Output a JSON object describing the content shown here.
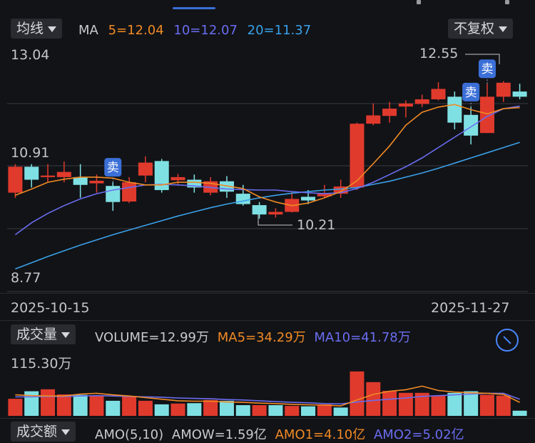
{
  "header": {
    "indicator_label": "均线",
    "ma_title": "MA",
    "ma5": "5=12.04",
    "ma10": "10=12.07",
    "ma20": "20=11.37",
    "adjust_label": "不复权"
  },
  "price_panel": {
    "high_label": "13.04",
    "mid_label": "10.91",
    "low_label": "8.77",
    "max_annot": "12.55",
    "min_annot": "10.21",
    "sell_markers": [
      "卖",
      "卖",
      "卖"
    ],
    "start_date": "2025-10-15",
    "end_date": "2025-11-27"
  },
  "volume_panel": {
    "indicator_label": "成交量",
    "volume": "VOLUME=12.99万",
    "ma5": "MA5=34.29万",
    "ma10": "MA10=41.78万",
    "max_label": "115.30万"
  },
  "amount_panel": {
    "indicator_label": "成交额",
    "amo": "AMO(5,10)",
    "amow": "AMOW=1.59亿",
    "amo1": "AMO1=4.10亿",
    "amo2": "AMO2=5.02亿"
  },
  "colors": {
    "up": "#e03a2d",
    "down": "#7fe0e3",
    "ma5": "#f08a24",
    "ma10": "#6a6df0",
    "ma20": "#3aa0e8",
    "marker": "#3b6fd8"
  },
  "chart_data": {
    "type": "candlestick",
    "ylim": [
      8.77,
      13.04
    ],
    "candles": [
      {
        "o": 10.4,
        "c": 10.9,
        "h": 10.95,
        "l": 10.3
      },
      {
        "o": 10.9,
        "c": 10.65,
        "h": 10.95,
        "l": 10.5
      },
      {
        "o": 10.7,
        "c": 10.73,
        "h": 10.95,
        "l": 10.6
      },
      {
        "o": 10.7,
        "c": 10.8,
        "h": 11.0,
        "l": 10.6
      },
      {
        "o": 10.7,
        "c": 10.55,
        "h": 10.95,
        "l": 10.3
      },
      {
        "o": 10.58,
        "c": 10.63,
        "h": 10.75,
        "l": 10.4
      },
      {
        "o": 10.53,
        "c": 10.22,
        "h": 10.6,
        "l": 10.05
      },
      {
        "o": 10.23,
        "c": 10.6,
        "h": 10.7,
        "l": 10.2
      },
      {
        "o": 10.73,
        "c": 10.98,
        "h": 11.1,
        "l": 10.6
      },
      {
        "o": 11.01,
        "c": 10.45,
        "h": 11.05,
        "l": 10.4
      },
      {
        "o": 10.64,
        "c": 10.7,
        "h": 10.76,
        "l": 10.55
      },
      {
        "o": 10.65,
        "c": 10.5,
        "h": 10.75,
        "l": 10.4
      },
      {
        "o": 10.4,
        "c": 10.62,
        "h": 10.7,
        "l": 10.35
      },
      {
        "o": 10.62,
        "c": 10.42,
        "h": 10.72,
        "l": 10.3
      },
      {
        "o": 10.38,
        "c": 10.18,
        "h": 10.55,
        "l": 10.15
      },
      {
        "o": 10.16,
        "c": 9.98,
        "h": 10.22,
        "l": 9.9
      },
      {
        "o": 9.98,
        "c": 10.03,
        "h": 10.1,
        "l": 9.92
      },
      {
        "o": 10.03,
        "c": 10.28,
        "h": 10.42,
        "l": 10.02
      },
      {
        "o": 10.32,
        "c": 10.25,
        "h": 10.45,
        "l": 10.18
      },
      {
        "o": 10.33,
        "c": 10.38,
        "h": 10.55,
        "l": 10.3
      },
      {
        "o": 10.38,
        "c": 10.52,
        "h": 10.65,
        "l": 10.3
      },
      {
        "o": 10.5,
        "c": 11.73,
        "h": 11.75,
        "l": 10.45
      },
      {
        "o": 11.73,
        "c": 11.89,
        "h": 12.12,
        "l": 11.7
      },
      {
        "o": 11.88,
        "c": 12.02,
        "h": 12.15,
        "l": 11.75
      },
      {
        "o": 12.06,
        "c": 12.12,
        "h": 12.18,
        "l": 11.85
      },
      {
        "o": 12.11,
        "c": 12.2,
        "h": 12.29,
        "l": 12.05
      },
      {
        "o": 12.2,
        "c": 12.4,
        "h": 12.53,
        "l": 12.18
      },
      {
        "o": 12.25,
        "c": 11.75,
        "h": 12.35,
        "l": 11.62
      },
      {
        "o": 11.9,
        "c": 11.5,
        "h": 12.05,
        "l": 11.33
      },
      {
        "o": 11.55,
        "c": 12.25,
        "h": 12.5,
        "l": 11.55
      },
      {
        "o": 12.25,
        "c": 12.52,
        "h": 12.55,
        "l": 12.15
      },
      {
        "o": 12.35,
        "c": 12.25,
        "h": 12.5,
        "l": 12.2
      }
    ],
    "ma5": [
      10.35,
      10.47,
      10.6,
      10.66,
      10.7,
      10.7,
      10.68,
      10.6,
      10.55,
      10.55,
      10.6,
      10.6,
      10.58,
      10.53,
      10.48,
      10.32,
      10.22,
      10.15,
      10.2,
      10.3,
      10.42,
      10.63,
      10.96,
      11.3,
      11.7,
      11.95,
      12.05,
      12.1,
      12.0,
      11.92,
      12.02,
      12.04
    ],
    "ma10": [
      9.59,
      9.82,
      10.0,
      10.15,
      10.28,
      10.38,
      10.45,
      10.5,
      10.55,
      10.56,
      10.55,
      10.53,
      10.5,
      10.47,
      10.46,
      10.45,
      10.45,
      10.42,
      10.4,
      10.38,
      10.4,
      10.48,
      10.6,
      10.75,
      10.9,
      11.07,
      11.27,
      11.47,
      11.67,
      11.87,
      12.02,
      12.07
    ],
    "ma20": [
      8.93,
      9.05,
      9.17,
      9.28,
      9.39,
      9.49,
      9.59,
      9.68,
      9.77,
      9.86,
      9.95,
      10.03,
      10.11,
      10.18,
      10.24,
      10.3,
      10.35,
      10.39,
      10.42,
      10.45,
      10.47,
      10.5,
      10.56,
      10.62,
      10.7,
      10.78,
      10.87,
      10.97,
      11.07,
      11.17,
      11.27,
      11.37
    ],
    "sell_indices": [
      6,
      28,
      29
    ],
    "volume": {
      "unit": "万",
      "ymax": 115.3,
      "values": [
        43,
        62,
        67,
        54,
        53,
        51,
        38,
        49,
        38,
        29,
        31,
        32,
        40,
        38,
        27,
        27,
        27,
        25,
        24,
        29,
        21,
        112,
        85,
        63,
        58,
        58,
        51,
        58,
        62,
        53,
        51,
        13
      ],
      "directions": [
        "up",
        "down",
        "up",
        "up",
        "down",
        "up",
        "down",
        "up",
        "up",
        "down",
        "up",
        "down",
        "up",
        "down",
        "down",
        "up",
        "down",
        "up",
        "down",
        "up",
        "down",
        "up",
        "up",
        "up",
        "up",
        "up",
        "up",
        "down",
        "down",
        "up",
        "up",
        "down"
      ],
      "ma5": [
        53,
        51,
        50,
        50,
        55,
        57,
        53,
        50,
        46,
        42,
        38,
        37,
        37,
        35,
        34,
        32,
        31,
        29,
        28,
        27,
        25,
        40,
        54,
        62,
        66,
        75,
        64,
        60,
        58,
        57,
        54,
        34
      ],
      "ma10": [
        48,
        48,
        49,
        49,
        50,
        51,
        50,
        49,
        48,
        47,
        45,
        44,
        43,
        41,
        40,
        38,
        36,
        34,
        33,
        31,
        30,
        35,
        39,
        42,
        45,
        49,
        51,
        53,
        55,
        57,
        57,
        42
      ]
    }
  }
}
